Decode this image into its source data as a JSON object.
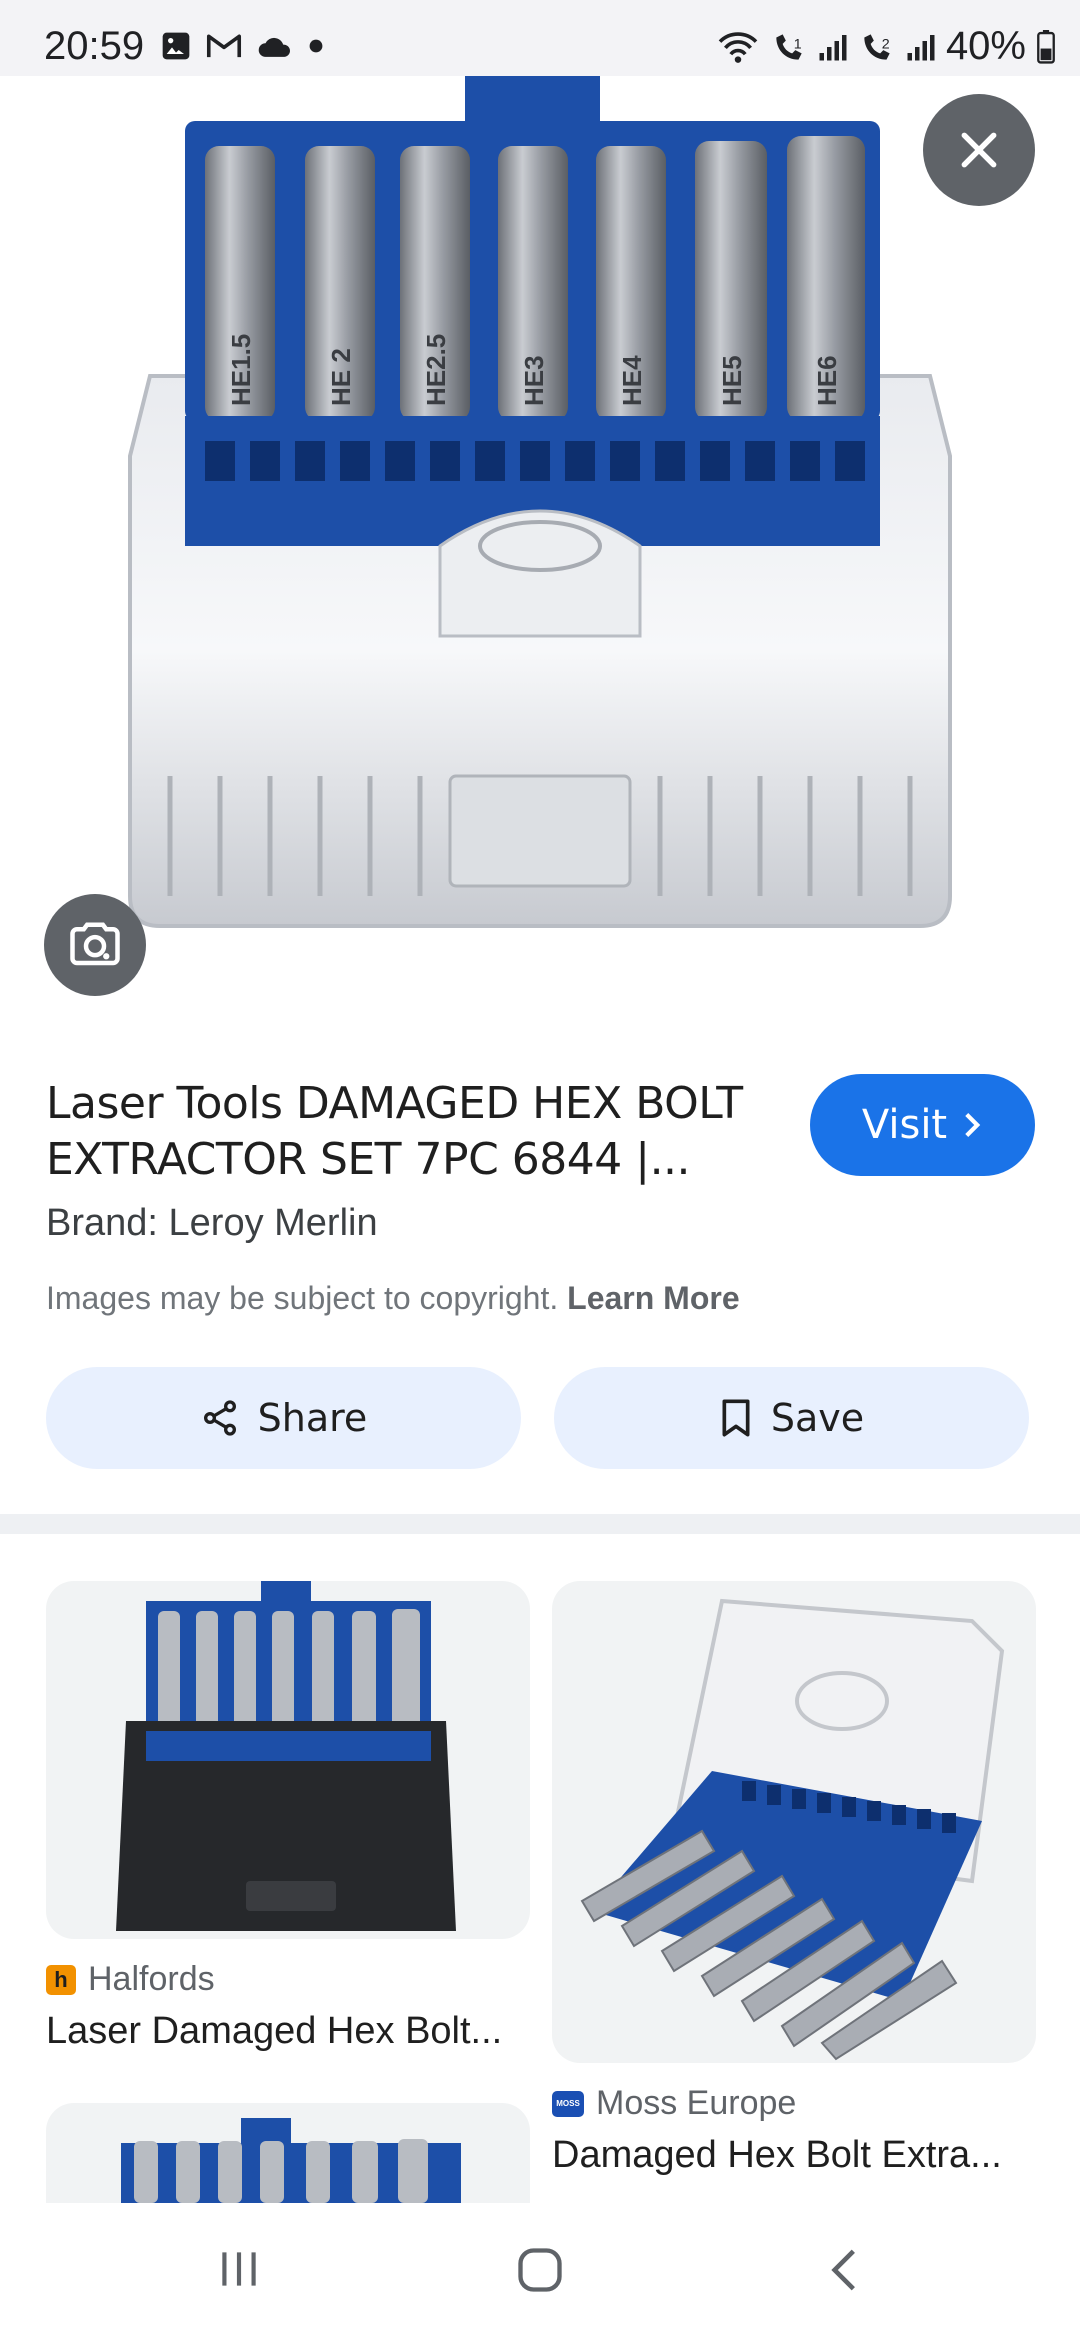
{
  "status_bar": {
    "time": "20:59",
    "battery": "40%",
    "icons": [
      "gallery-icon",
      "gmail-icon",
      "cloud-icon",
      "dot-icon",
      "wifi-icon",
      "wifi-call-1-icon",
      "signal-1-icon",
      "wifi-call-2-icon",
      "signal-2-icon",
      "battery-icon"
    ]
  },
  "hero": {
    "bit_labels": [
      "HE1.5",
      "HE 2",
      "HE2.5",
      "HE3",
      "HE4",
      "HE5",
      "HE6"
    ],
    "close_icon": "close-icon",
    "lens_icon": "google-lens-icon"
  },
  "result": {
    "title": "Laser Tools DAMAGED HEX BOLT EXTRACTOR SET 7PC 6844 |...",
    "visit_label": "Visit",
    "brand": "Brand: Leroy Merlin",
    "copyright_text": "Images may be subject to copyright.",
    "learn_more": "Learn More",
    "share_label": "Share",
    "save_label": "Save"
  },
  "related": [
    {
      "source": "Halfords",
      "favicon_letter": "h",
      "title": "Laser Damaged Hex Bolt..."
    },
    {
      "source": "Moss Europe",
      "favicon_letter": "MOSS",
      "title": "Damaged Hex Bolt Extra..."
    }
  ],
  "colors": {
    "accent": "#1a73e8",
    "tool_blue": "#1d4fa8",
    "chip_bg": "#e8f0fe",
    "overlay_btn": "#5f6368",
    "halfords_orange": "#f29100"
  }
}
